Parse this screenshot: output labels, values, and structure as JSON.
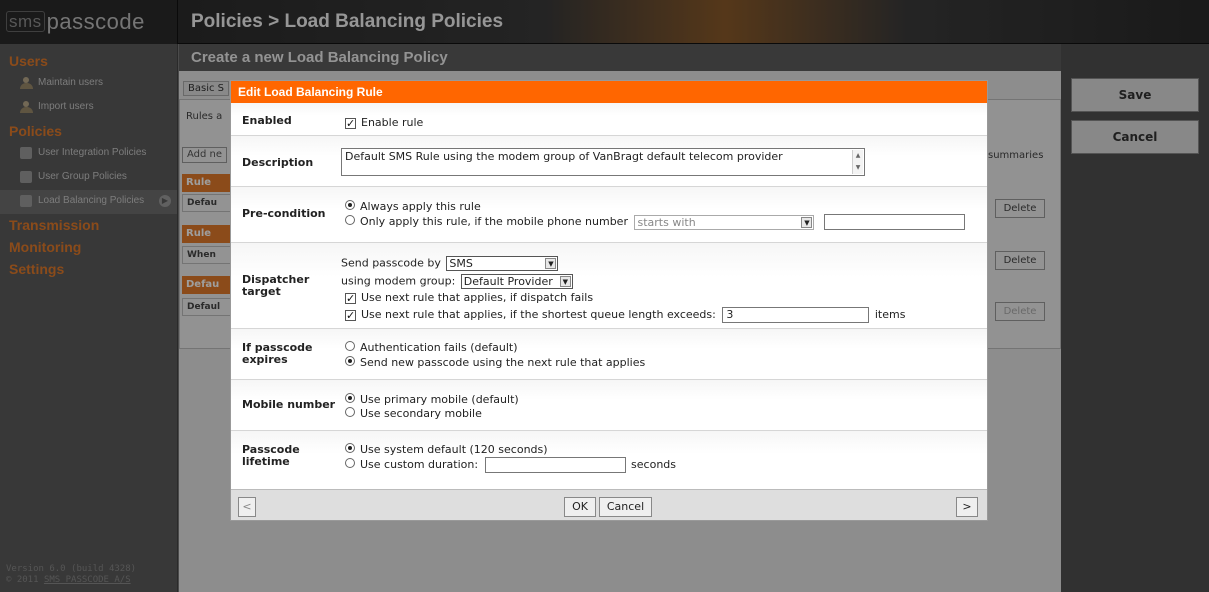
{
  "app": {
    "logo_sms": "sms",
    "logo_text": "passcode",
    "page_title": "Policies > Load Balancing Policies"
  },
  "sidebar": {
    "users_heading": "Users",
    "maintain_users": "Maintain users",
    "import_users": "Import users",
    "policies_heading": "Policies",
    "user_integration_policies": "User Integration Policies",
    "user_group_policies": "User Group Policies",
    "load_balancing_policies": "Load Balancing Policies",
    "transmission_heading": "Transmission",
    "monitoring_heading": "Monitoring",
    "settings_heading": "Settings",
    "version_line1": "Version 6.0 (build 4328)",
    "version_prefix": "© 2011 ",
    "version_link": "SMS PASSCODE A/S"
  },
  "main": {
    "header": "Create a new Load Balancing Policy",
    "tab_basic": "Basic S",
    "rules_text": "Rules a",
    "add_button": "Add ne",
    "summaries_text": "summaries",
    "band1": "Rule",
    "row1": "Defau",
    "band2": "Rule",
    "row2": "When",
    "band3": "Defau",
    "row3": "Defaul",
    "delete1": "Delete",
    "delete2": "Delete",
    "delete3": "Delete"
  },
  "actions": {
    "save": "Save",
    "cancel": "Cancel"
  },
  "dialog": {
    "title": "Edit Load Balancing Rule",
    "enabled_label": "Enabled",
    "enable_rule": "Enable rule",
    "description_label": "Description",
    "description_value": "Default SMS Rule using the modem group of VanBragt default telecom provider",
    "precondition_label": "Pre-condition",
    "always_apply": "Always apply this rule",
    "only_apply": "Only apply this rule, if the mobile phone number",
    "starts_with": "starts with",
    "number_value": "",
    "dispatcher_label_1": "Dispatcher",
    "dispatcher_label_2": "target",
    "send_by": "Send passcode by",
    "send_by_value": "SMS",
    "using_modem": "using modem group:",
    "modem_value": "Default Provider",
    "next_if_fails": "Use next rule that applies, if dispatch fails",
    "next_if_queue": "Use next rule that applies, if the shortest queue length exceeds:",
    "queue_value": "3",
    "items": "items",
    "expires_label_1": "If passcode",
    "expires_label_2": "expires",
    "auth_fails": "Authentication fails (default)",
    "send_new": "Send new passcode using the next rule that applies",
    "mobile_label": "Mobile number",
    "primary": "Use primary mobile (default)",
    "secondary": "Use secondary mobile",
    "lifetime_label_1": "Passcode",
    "lifetime_label_2": "lifetime",
    "system_default": "Use system default (120 seconds)",
    "custom": "Use custom duration:",
    "custom_value": "",
    "seconds": "seconds",
    "prev": "<",
    "ok": "OK",
    "cancel": "Cancel",
    "next": ">"
  }
}
